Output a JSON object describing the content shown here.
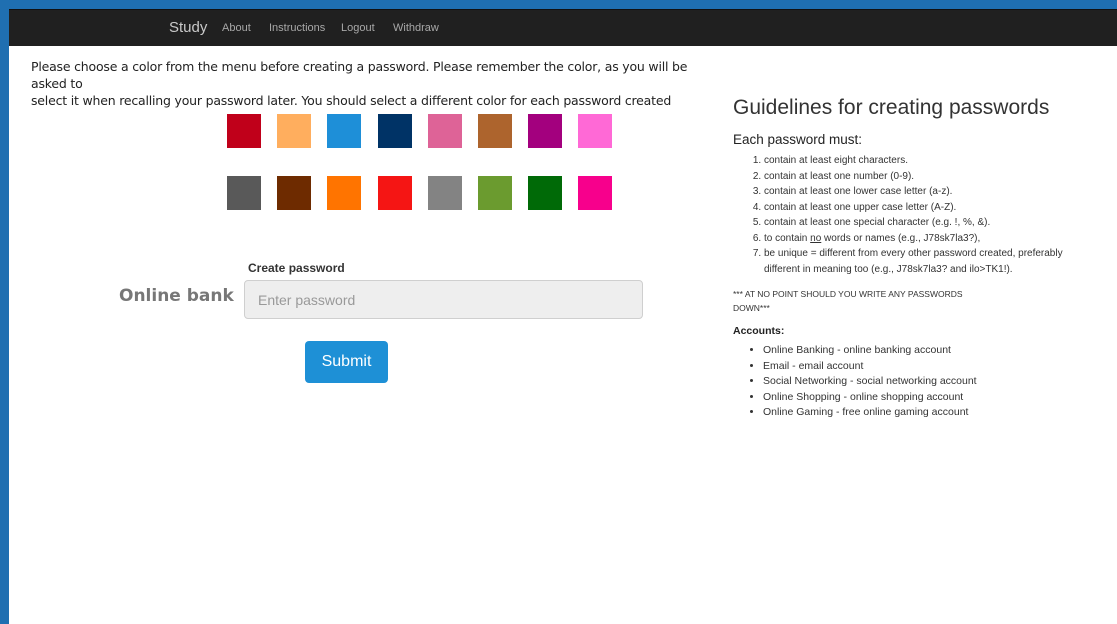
{
  "navbar": {
    "brand": "Study",
    "links": [
      "About",
      "Instructions",
      "Logout",
      "Withdraw"
    ]
  },
  "intro": {
    "line1": "Please choose a color from the menu before creating a password. Please remember the color, as you will be asked to",
    "line2": "select it when recalling your password later. You should select a different color for each password created"
  },
  "colors": {
    "row1": [
      "#c0001a",
      "#ffae5e",
      "#1e8fd8",
      "#003366",
      "#de6397",
      "#ad642d",
      "#a3007e",
      "#ff69d6"
    ],
    "row2": [
      "#595959",
      "#6e2b00",
      "#ff7400",
      "#f51514",
      "#838383",
      "#6b9b2f",
      "#006a07",
      "#f7008c"
    ]
  },
  "form": {
    "field_label": "Create password",
    "account_label": "Online bank",
    "placeholder": "Enter password",
    "submit_label": "Submit"
  },
  "guidelines": {
    "title": "Guidelines for creating passwords",
    "subtitle": "Each password must:",
    "rules": [
      "contain at least eight characters.",
      "contain at least one number (0-9).",
      "contain at least one lower case letter (a-z).",
      "contain at least one upper case letter (A-Z).",
      "contain at least one special character (e.g. !, %, &).",
      "to contain no words or names (e.g., J78sk7la3?),",
      "be unique = different from every other password created, preferably different in meaning too (e.g., J78sk7la3? and ilo>TK1!)."
    ],
    "rule6_prefix": "to contain ",
    "rule6_underline": "no",
    "rule6_suffix": " words or names (e.g., J78sk7la3?),",
    "warning": "*** AT NO POINT SHOULD YOU WRITE ANY PASSWORDS DOWN***",
    "accounts_title": "Accounts:",
    "accounts": [
      "Online Banking - online banking account",
      "Email - email account",
      "Social Networking - social networking account",
      "Online Shopping - online shopping account",
      "Online Gaming - free online gaming account"
    ]
  }
}
